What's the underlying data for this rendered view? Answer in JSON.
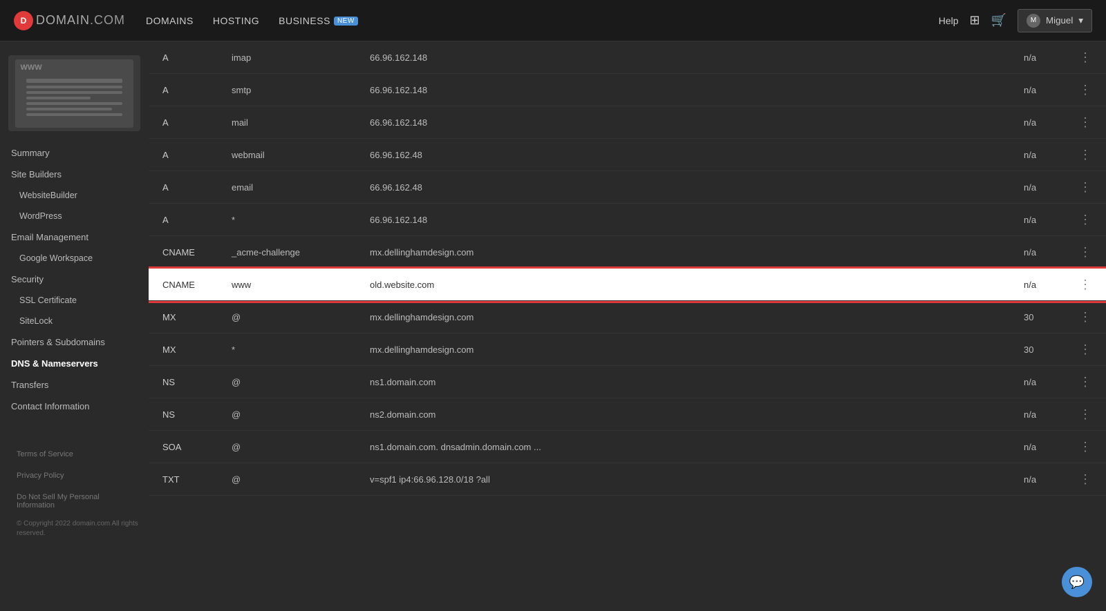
{
  "topnav": {
    "logo_circle": "D",
    "logo_domain": "DOMAIN",
    "logo_com": ".COM",
    "nav_items": [
      {
        "id": "domains",
        "label": "DOMAINS",
        "badge": null
      },
      {
        "id": "hosting",
        "label": "HOSTING",
        "badge": null
      },
      {
        "id": "business",
        "label": "BUSINESS",
        "badge": "NEW"
      }
    ],
    "help_label": "Help",
    "user_name": "Miguel",
    "user_chevron": "▾"
  },
  "sidebar": {
    "thumbnail_www": "WWW",
    "nav_items": [
      {
        "id": "summary",
        "label": "Summary",
        "level": 0,
        "active": false
      },
      {
        "id": "site-builders",
        "label": "Site Builders",
        "level": 0,
        "active": false
      },
      {
        "id": "website-builder",
        "label": "WebsiteBuilder",
        "level": 1,
        "active": false
      },
      {
        "id": "wordpress",
        "label": "WordPress",
        "level": 1,
        "active": false
      },
      {
        "id": "email-management",
        "label": "Email Management",
        "level": 0,
        "active": false
      },
      {
        "id": "google-workspace",
        "label": "Google Workspace",
        "level": 1,
        "active": false
      },
      {
        "id": "security",
        "label": "Security",
        "level": 0,
        "active": false
      },
      {
        "id": "ssl-certificate",
        "label": "SSL Certificate",
        "level": 1,
        "active": false
      },
      {
        "id": "sitelock",
        "label": "SiteLock",
        "level": 1,
        "active": false
      },
      {
        "id": "pointers-subdomains",
        "label": "Pointers & Subdomains",
        "level": 0,
        "active": false
      },
      {
        "id": "dns-nameservers",
        "label": "DNS & Nameservers",
        "level": 0,
        "active": true
      },
      {
        "id": "transfers",
        "label": "Transfers",
        "level": 0,
        "active": false
      },
      {
        "id": "contact-information",
        "label": "Contact Information",
        "level": 0,
        "active": false
      }
    ],
    "footer": {
      "terms": "Terms of Service",
      "privacy": "Privacy Policy",
      "do_not_sell": "Do Not Sell My Personal Information",
      "copyright": "© Copyright 2022 domain.com\nAll rights reserved."
    }
  },
  "dns_records": [
    {
      "type": "A",
      "name": "imap",
      "value": "66.96.162.148",
      "ttl": "n/a",
      "highlighted": false
    },
    {
      "type": "A",
      "name": "smtp",
      "value": "66.96.162.148",
      "ttl": "n/a",
      "highlighted": false
    },
    {
      "type": "A",
      "name": "mail",
      "value": "66.96.162.148",
      "ttl": "n/a",
      "highlighted": false
    },
    {
      "type": "A",
      "name": "webmail",
      "value": "66.96.162.48",
      "ttl": "n/a",
      "highlighted": false
    },
    {
      "type": "A",
      "name": "email",
      "value": "66.96.162.48",
      "ttl": "n/a",
      "highlighted": false
    },
    {
      "type": "A",
      "name": "*",
      "value": "66.96.162.148",
      "ttl": "n/a",
      "highlighted": false
    },
    {
      "type": "CNAME",
      "name": "_acme-challenge",
      "value": "mx.dellinghamdesign.com",
      "ttl": "n/a",
      "highlighted": false
    },
    {
      "type": "CNAME",
      "name": "www",
      "value": "old.website.com",
      "ttl": "n/a",
      "highlighted": true
    },
    {
      "type": "MX",
      "name": "@",
      "value": "mx.dellinghamdesign.com",
      "ttl": "30",
      "highlighted": false
    },
    {
      "type": "MX",
      "name": "*",
      "value": "mx.dellinghamdesign.com",
      "ttl": "30",
      "highlighted": false
    },
    {
      "type": "NS",
      "name": "@",
      "value": "ns1.domain.com",
      "ttl": "n/a",
      "highlighted": false
    },
    {
      "type": "NS",
      "name": "@",
      "value": "ns2.domain.com",
      "ttl": "n/a",
      "highlighted": false
    },
    {
      "type": "SOA",
      "name": "@",
      "value": "ns1.domain.com. dnsadmin.domain.com ...",
      "ttl": "n/a",
      "highlighted": false
    },
    {
      "type": "TXT",
      "name": "@",
      "value": "v=spf1 ip4:66.96.128.0/18 ?all",
      "ttl": "n/a",
      "highlighted": false
    }
  ],
  "chat_icon": "💬"
}
